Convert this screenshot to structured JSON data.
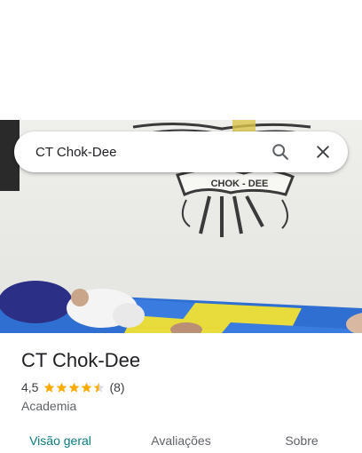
{
  "search": {
    "value": "CT Chok-Dee",
    "placeholder": ""
  },
  "photo": {
    "sign_text": "CHOK - DEE"
  },
  "place": {
    "name": "CT Chok-Dee",
    "rating": "4,5",
    "rating_fraction": 0.9,
    "review_count": "(8)",
    "category": "Academia"
  },
  "tabs": [
    {
      "label": "Visão geral",
      "active": true
    },
    {
      "label": "Avaliações",
      "active": false
    },
    {
      "label": "Sobre",
      "active": false
    }
  ],
  "colors": {
    "star": "#f9ab00",
    "tab_active": "#0b7a80",
    "star_empty": "#dadce0"
  },
  "icons": {
    "search": "search-icon",
    "close": "close-icon",
    "star": "star-icon"
  }
}
